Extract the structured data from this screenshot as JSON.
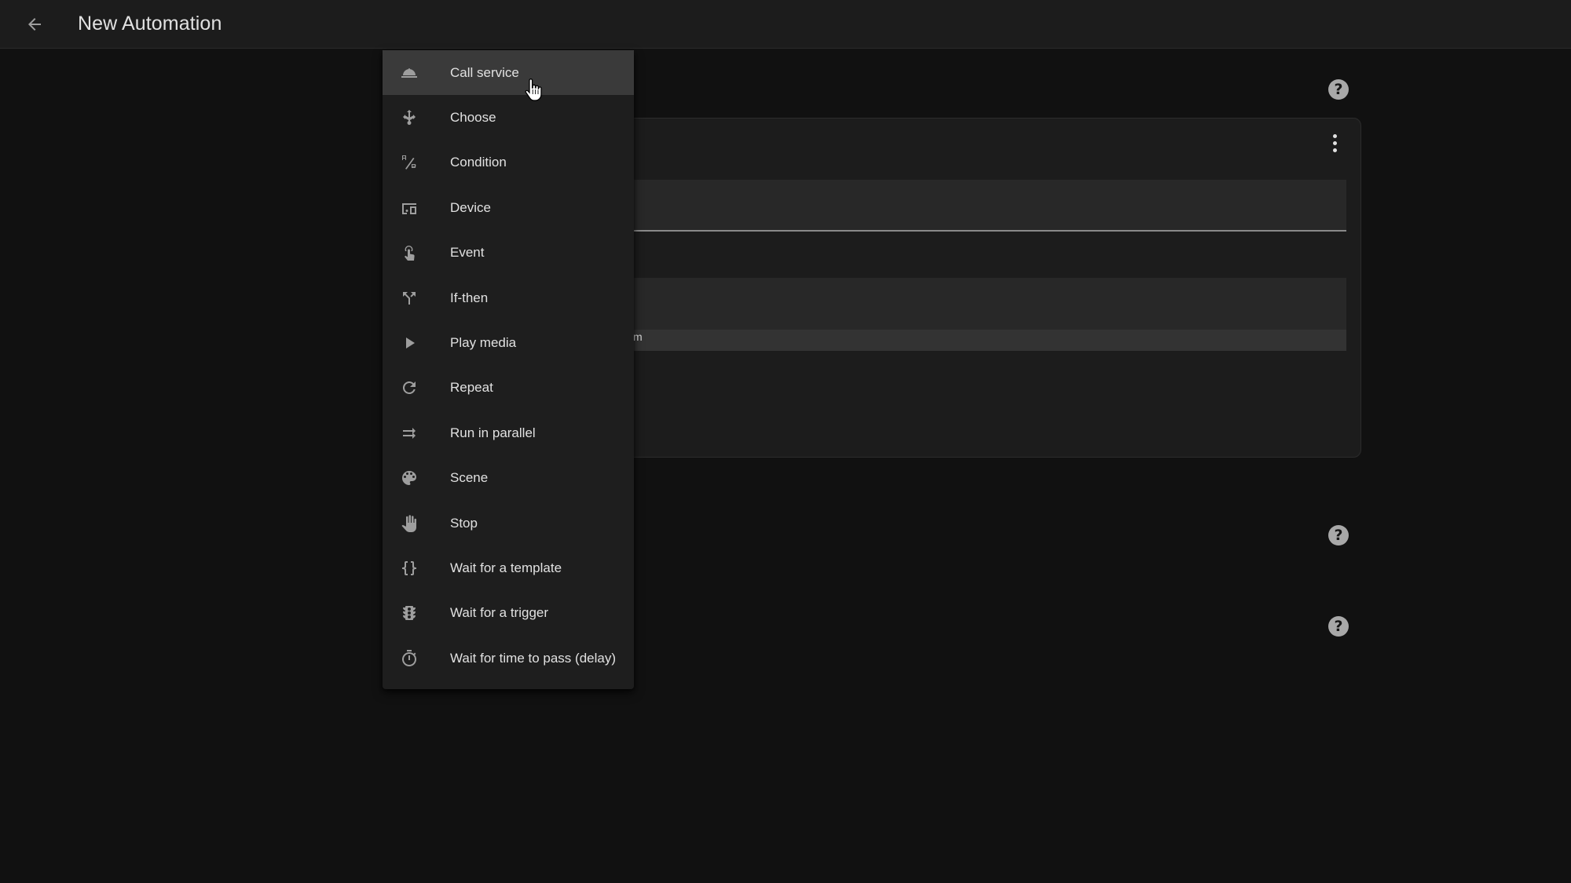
{
  "header": {
    "back_icon": "arrow-left-icon",
    "title": "New Automation"
  },
  "action_menu": {
    "hovered_index": 0,
    "items": [
      {
        "label": "Call service",
        "icon": "room-service-bell-icon"
      },
      {
        "label": "Choose",
        "icon": "source-branch-arrows-icon"
      },
      {
        "label": "Condition",
        "icon": "a-b-condition-icon"
      },
      {
        "label": "Device",
        "icon": "devices-icon"
      },
      {
        "label": "Event",
        "icon": "gesture-tap-icon"
      },
      {
        "label": "If-then",
        "icon": "call-split-icon"
      },
      {
        "label": "Play media",
        "icon": "play-icon"
      },
      {
        "label": "Repeat",
        "icon": "refresh-icon"
      },
      {
        "label": "Run in parallel",
        "icon": "parallel-arrows-icon"
      },
      {
        "label": "Scene",
        "icon": "palette-icon"
      },
      {
        "label": "Stop",
        "icon": "hand-stop-icon"
      },
      {
        "label": "Wait for a template",
        "icon": "code-braces-icon"
      },
      {
        "label": "Wait for a trigger",
        "icon": "traffic-light-icon"
      },
      {
        "label": "Wait for time to pass (delay)",
        "icon": "timer-icon"
      }
    ]
  },
  "card": {
    "overflow_icon": "dots-vertical-icon",
    "field_fragment": "m"
  },
  "help_icons": [
    "help-circle-icon",
    "help-circle-icon",
    "help-circle-icon"
  ],
  "help_glyph": "?",
  "colors": {
    "background": "#111111",
    "header": "#1c1c1c",
    "menu": "#1e1e1e",
    "menu_hover": "#3a3a3a",
    "text": "#e1e1e1",
    "icon": "#9e9e9e"
  }
}
